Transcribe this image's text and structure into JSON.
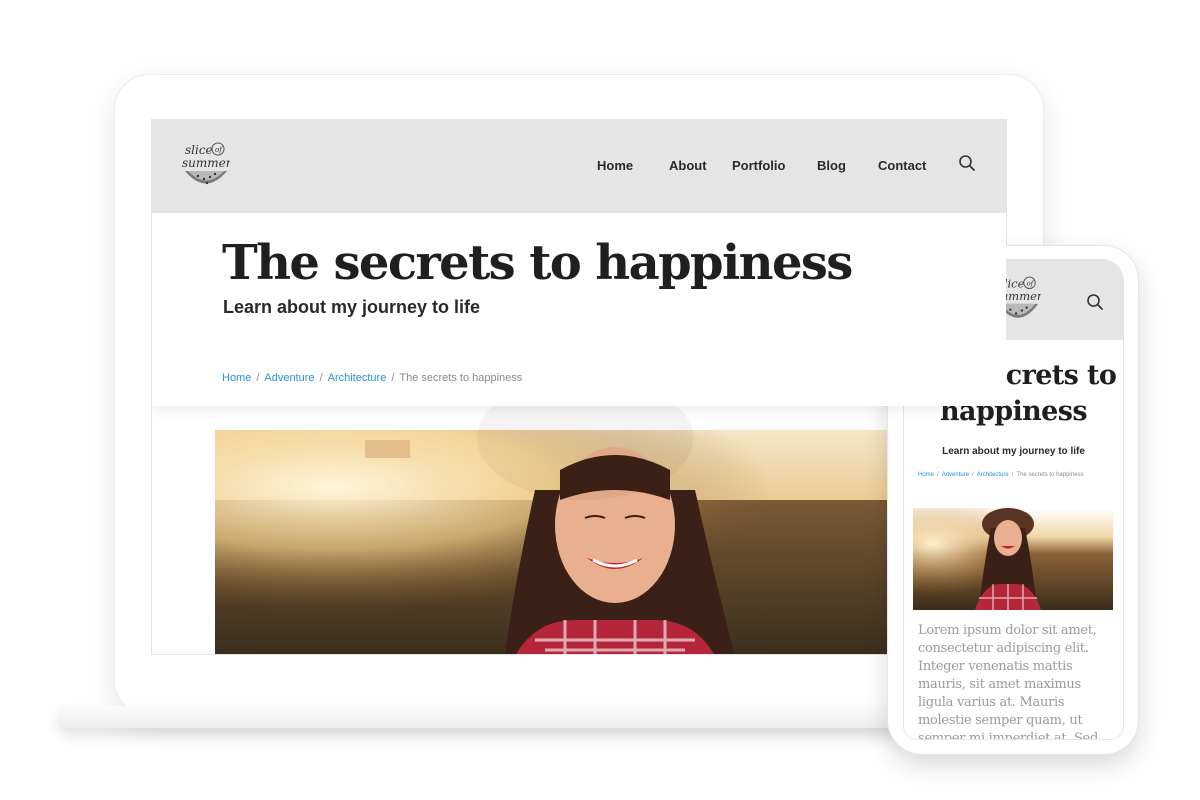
{
  "site": {
    "logo_text_line1": "slice",
    "logo_text_line2": "summer",
    "logo_text_of": "of"
  },
  "nav": {
    "items": [
      {
        "label": "Home"
      },
      {
        "label": "About"
      },
      {
        "label": "Portfolio"
      },
      {
        "label": "Blog"
      },
      {
        "label": "Contact"
      }
    ],
    "search_icon": "search-icon",
    "menu_icon": "hamburger-menu-icon"
  },
  "post": {
    "title": "The secrets to happiness",
    "subtitle": "Learn about my journey to life",
    "body": "Lorem ipsum dolor sit amet, consectetur adipiscing elit. Integer venenatis mattis mauris, sit amet maximus ligula varius at. Mauris molestie semper quam, ut semper mi imperdiet at. Sed tempus augue dictum"
  },
  "breadcrumb": {
    "items": [
      "Home",
      "Adventure",
      "Architecture"
    ],
    "separator": "/",
    "current": "The secrets to happiness"
  },
  "colors": {
    "header_bg": "#e5e5e5",
    "link": "#2b8fd6",
    "title": "#1f1f1f",
    "body_text": "#9a9a9a"
  }
}
